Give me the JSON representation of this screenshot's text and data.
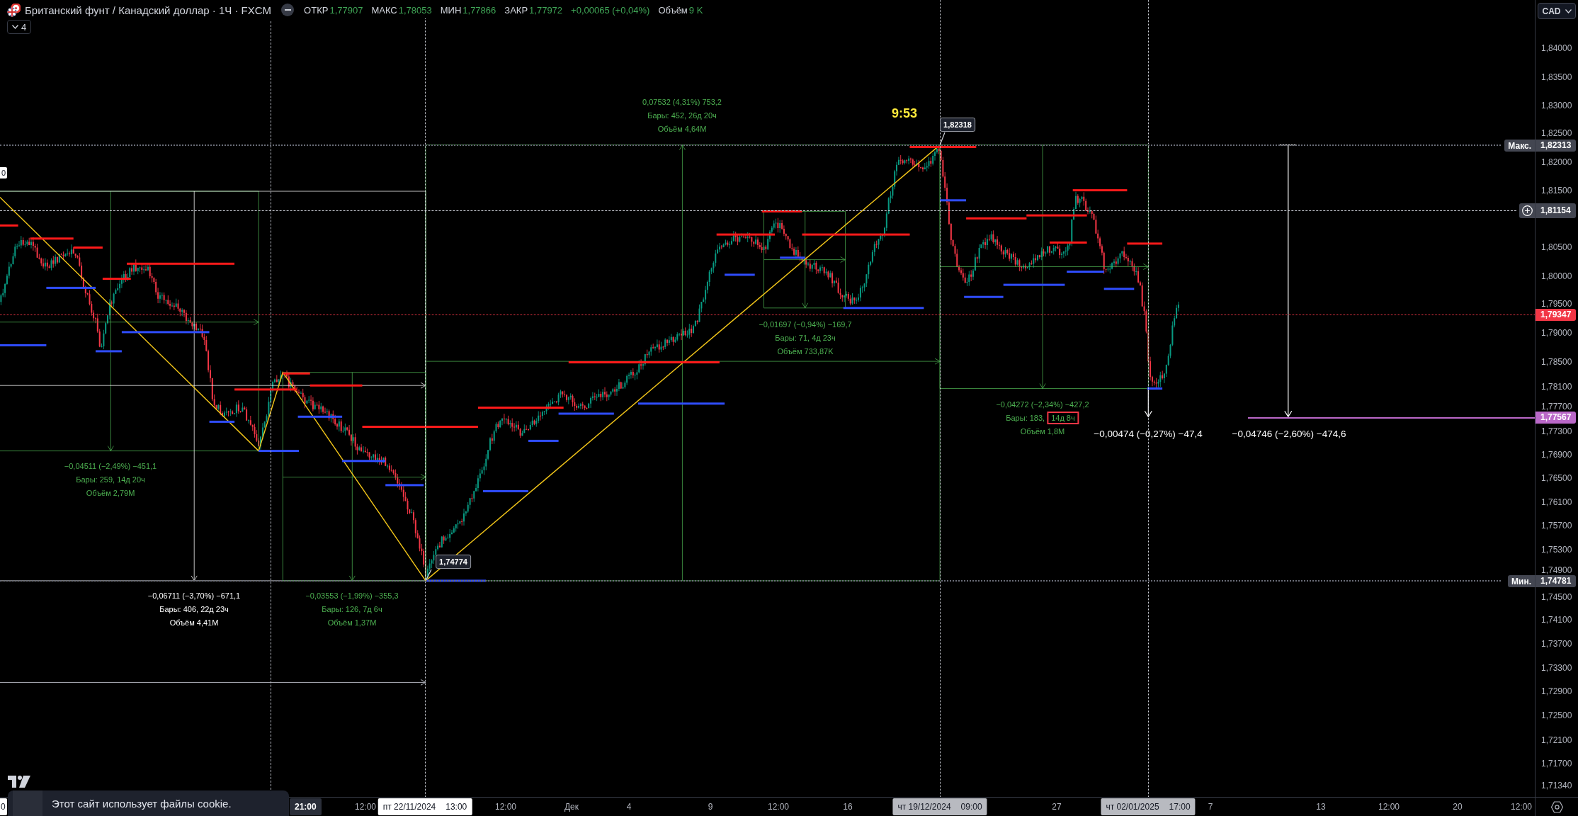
{
  "header": {
    "title": "Британский фунт / Канадский доллар · 1Ч · FXCM",
    "quote": [
      {
        "label": "ОТКР",
        "value": "1,77907"
      },
      {
        "label": "МАКС",
        "value": "1,78053"
      },
      {
        "label": "МИН",
        "value": "1,77866"
      },
      {
        "label": "ЗАКР",
        "value": "1,77972"
      }
    ],
    "change": "+0,00065 (+0,04%)",
    "volume": {
      "label": "Объём",
      "value": "9 K"
    },
    "indicators_count": "4"
  },
  "currency_button": "CAD",
  "chart": {
    "edge_label": "0",
    "timer": "9:53",
    "price_notes": [
      "1,82318",
      "1,74774"
    ],
    "ranges": [
      {
        "kind": "date_price",
        "color": "#4caf50",
        "change": "−0,04511 (−2,49%) −451,1",
        "bars": "Бары: 259, 14д 20ч",
        "volume": "Объём 2,79M"
      },
      {
        "kind": "date_price",
        "color": "#ffffff",
        "change": "−0,06711 (−3,70%) −671,1",
        "bars": "Бары: 406, 22д 23ч",
        "volume": "Объём 4,41M"
      },
      {
        "kind": "date_price",
        "color": "#4caf50",
        "change": "−0,03553 (−1,99%) −355,3",
        "bars": "Бары: 126, 7д 6ч",
        "volume": "Объём 1,37M"
      },
      {
        "kind": "date_price",
        "color": "#4caf50",
        "change": "0,07532 (4,31%) 753,2",
        "bars": "Бары: 452, 26д 20ч",
        "volume": "Объём 4,64M"
      },
      {
        "kind": "date_price",
        "color": "#4caf50",
        "change": "−0,01697 (−0,94%) −169,7",
        "bars": "Бары: 71, 4д 23ч",
        "volume": "Объём 733,87K"
      },
      {
        "kind": "date_price",
        "color": "#4caf50",
        "change": "−0,04272 (−2,34%) −427,2",
        "bars": "Бары: 183,",
        "bars_marked": "14д 8ч",
        "volume": "Объём 1,8M"
      },
      {
        "kind": "price",
        "color": "#ffffff",
        "change": "−0,00474 (−0,27%) −47,4"
      },
      {
        "kind": "price",
        "color": "#ffffff",
        "change": "−0,04746 (−2,60%) −474,6"
      }
    ]
  },
  "price_axis": {
    "ticks": [
      "1,84000",
      "1,83500",
      "1,83000",
      "1,82500",
      "1,82000",
      "1,81500",
      "1,80500",
      "1,80000",
      "1,79500",
      "1,79000",
      "1,78500",
      "1,78100",
      "1,77700",
      "1,77300",
      "1,76900",
      "1,76500",
      "1,76100",
      "1,75700",
      "1,75300",
      "1,74900",
      "1,74500",
      "1,74100",
      "1,73700",
      "1,73300",
      "1,72900",
      "1,72500",
      "1,72100",
      "1,71700",
      "1,71340"
    ],
    "markers": [
      {
        "kind": "max",
        "tag": "Макс.",
        "value": "1,82313",
        "color": "#434651"
      },
      {
        "kind": "alert",
        "value": "1,81154",
        "color": "#434651"
      },
      {
        "kind": "last",
        "value": "1,79347",
        "color": "#f23645"
      },
      {
        "kind": "line",
        "value": "1,77567",
        "color": "#ba68c8"
      },
      {
        "kind": "min",
        "tag": "Мин.",
        "value": "1,74781",
        "color": "#434651"
      }
    ]
  },
  "time_axis": {
    "ticks": [
      "12:00",
      "12:00",
      "Дек",
      "4",
      "9",
      "12:00",
      "16",
      "27",
      "7",
      "13",
      "12:00",
      "20",
      "12:00"
    ],
    "markers": [
      {
        "kind": "crosshair",
        "time": "0"
      },
      {
        "kind": "partial",
        "time": "21:00"
      },
      {
        "kind": "crosshair",
        "date": "пт 22/11/2024",
        "time": "13:00"
      },
      {
        "kind": "line",
        "date": "чт 19/12/2024",
        "time": "09:00"
      },
      {
        "kind": "line",
        "date": "чт 02/01/2025",
        "time": "17:00"
      }
    ]
  },
  "cookie_banner": {
    "text": "Этот сайт использует файлы cookie."
  }
}
